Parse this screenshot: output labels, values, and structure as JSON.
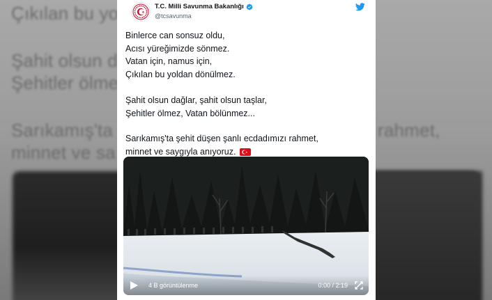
{
  "background": {
    "lines": [
      "Çıkılan bu yo",
      "Şahit olsun d",
      "Şehitler ölme",
      "Sarıkamış'ta",
      "minnet ve sa"
    ],
    "right_fragments": [
      "rahmet,"
    ]
  },
  "tweet": {
    "display_name": "T.C. Milli Savunma Bakanlığı",
    "handle": "@tcsavunma",
    "paragraphs": [
      [
        "Binlerce can sonsuz oldu,",
        "Acısı yüreğimizde sönmez.",
        "Vatan için, namus için,",
        "Çıkılan bu yoldan dönülmez."
      ],
      [
        "Şahit olsun dağlar, şahit olsun taşlar,",
        "Şehitler ölmez, Vatan bölünmez..."
      ],
      [
        "Sarıkamış'ta şehit düşen şanlı ecdadımızı rahmet,",
        "minnet ve saygıyla anıyoruz."
      ]
    ],
    "video": {
      "views": "4 B görüntülenme",
      "time": "0:00 / 2:19"
    }
  },
  "colors": {
    "verified": "#1d9bf0",
    "twitter": "#1d9bf0",
    "flag_red": "#e30a17",
    "text": "#0f1419",
    "muted": "#536471"
  },
  "icons": [
    "verified-badge-icon",
    "twitter-bird-icon",
    "turkey-flag-icon",
    "play-icon",
    "fullscreen-icon"
  ]
}
